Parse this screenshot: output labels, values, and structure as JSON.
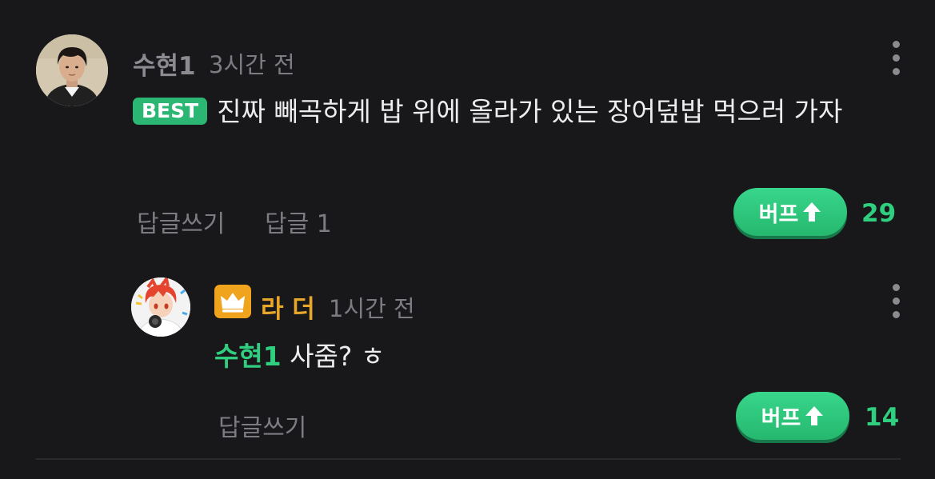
{
  "comment": {
    "author": "수현1",
    "time": "3시간 전",
    "badge": "BEST",
    "text": "진짜 빼곡하게 밥 위에 올라가 있는 장어덮밥 먹으러 가자",
    "reply_label": "답글쓰기",
    "replies_label": "답글 1",
    "buff_label": "버프",
    "buff_count": "29",
    "menu_icon": "more-vertical-icon"
  },
  "reply": {
    "author": "라 더",
    "time": "1시간 전",
    "mention": "수현1",
    "text": " 사줌? ㅎ",
    "reply_label": "답글쓰기",
    "buff_label": "버프",
    "buff_count": "14",
    "author_badge_icon": "crown-icon",
    "menu_icon": "more-vertical-icon"
  },
  "colors": {
    "background": "#18181b",
    "accent_green": "#2fcf7f",
    "badge_gold": "#f0a31c",
    "author_gold": "#e8a62a"
  }
}
